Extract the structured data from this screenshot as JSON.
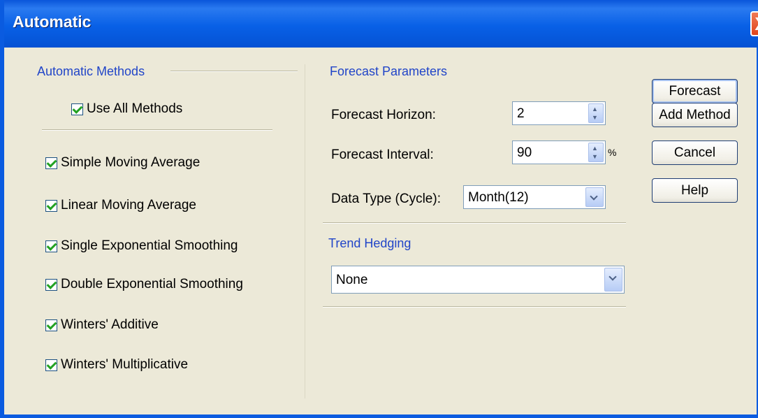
{
  "window": {
    "title": "Automatic",
    "close_label": "X"
  },
  "automatic_methods": {
    "group_label": "Automatic Methods",
    "use_all": {
      "label": "Use All Methods",
      "checked": true
    },
    "methods": [
      {
        "label": "Simple Moving Average",
        "checked": true
      },
      {
        "label": "Linear Moving Average",
        "checked": true
      },
      {
        "label": "Single Exponential Smoothing",
        "checked": true
      },
      {
        "label": "Double Exponential Smoothing",
        "checked": true
      },
      {
        "label": "Winters' Additive",
        "checked": true
      },
      {
        "label": "Winters' Multiplicative",
        "checked": true
      }
    ]
  },
  "forecast_parameters": {
    "group_label": "Forecast Parameters",
    "horizon": {
      "label": "Forecast Horizon:",
      "value": "2"
    },
    "interval": {
      "label": "Forecast Interval:",
      "value": "90",
      "unit": "%"
    },
    "data_type": {
      "label": "Data Type (Cycle):",
      "value": "Month(12)"
    }
  },
  "trend_hedging": {
    "group_label": "Trend Hedging",
    "value": "None"
  },
  "buttons": {
    "forecast": "Forecast",
    "add_method": "Add Method",
    "cancel": "Cancel",
    "help": "Help"
  }
}
